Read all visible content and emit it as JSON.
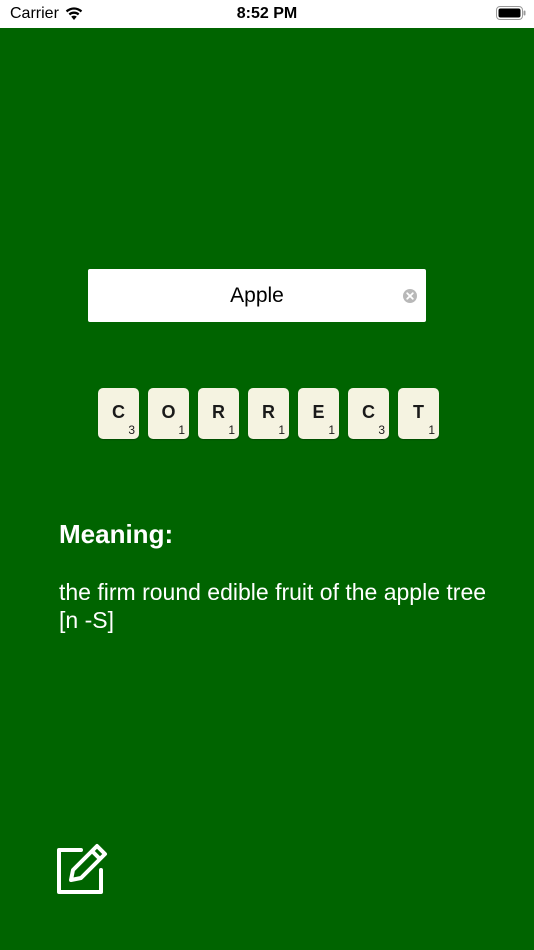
{
  "status_bar": {
    "carrier": "Carrier",
    "time": "8:52 PM"
  },
  "search": {
    "value": "Apple",
    "placeholder": ""
  },
  "tiles": [
    {
      "letter": "C",
      "score": "3"
    },
    {
      "letter": "O",
      "score": "1"
    },
    {
      "letter": "R",
      "score": "1"
    },
    {
      "letter": "R",
      "score": "1"
    },
    {
      "letter": "E",
      "score": "1"
    },
    {
      "letter": "C",
      "score": "3"
    },
    {
      "letter": "T",
      "score": "1"
    }
  ],
  "meaning": {
    "heading": "Meaning:",
    "text": "the firm round edible fruit of the apple tree [n -S]"
  },
  "colors": {
    "background": "#006400",
    "tile": "#f5f3e1",
    "text": "#ffffff"
  },
  "icons": {
    "wifi": "wifi-icon",
    "battery": "battery-icon",
    "clear": "clear-icon",
    "edit": "edit-icon"
  }
}
